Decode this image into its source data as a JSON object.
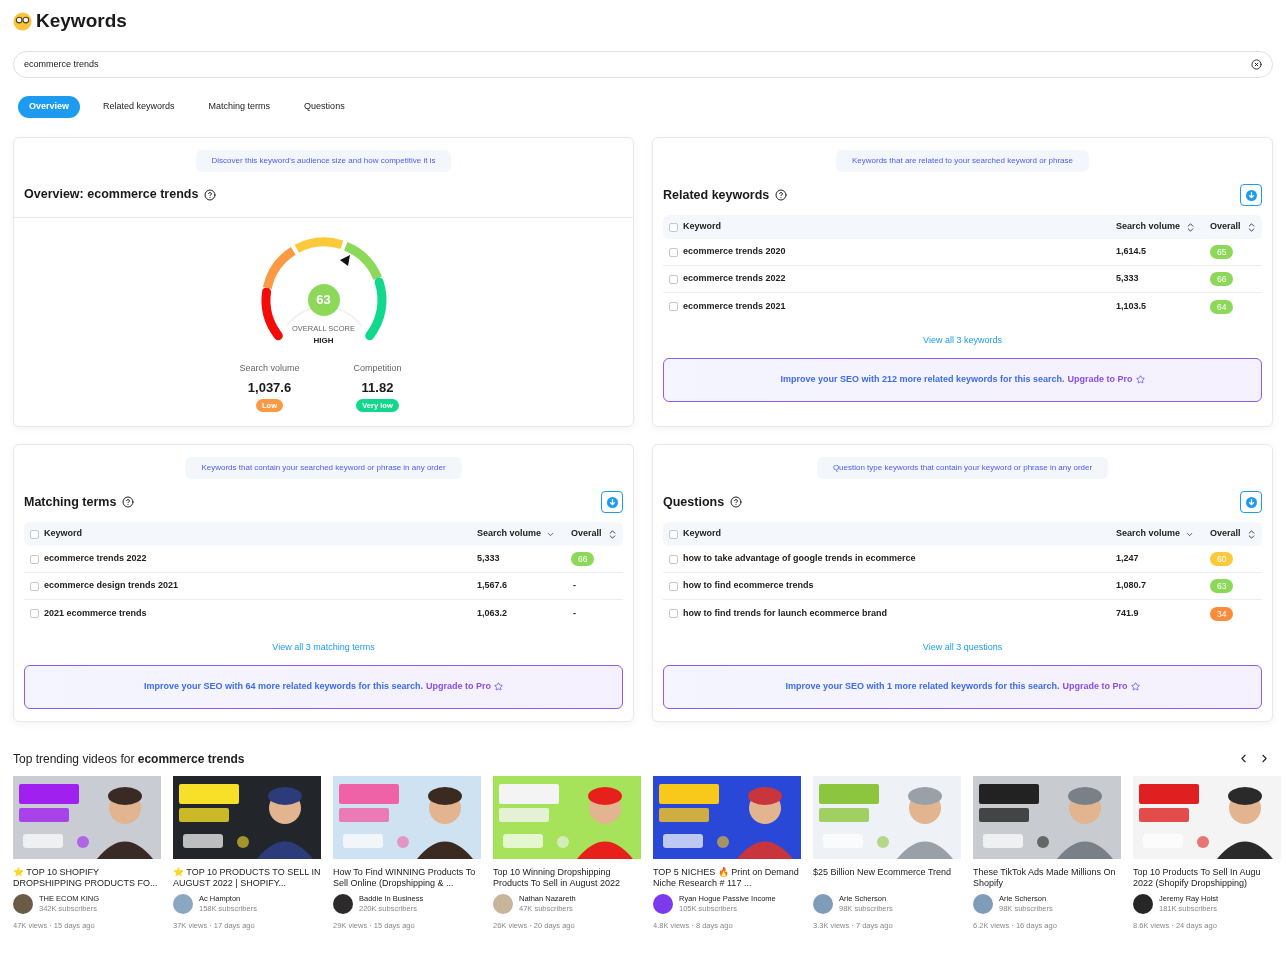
{
  "header": {
    "title": "Keywords"
  },
  "search": {
    "value": "ecommerce trends"
  },
  "tabs": [
    {
      "label": "Overview",
      "selected": true
    },
    {
      "label": "Related keywords",
      "selected": false
    },
    {
      "label": "Matching terms",
      "selected": false
    },
    {
      "label": "Questions",
      "selected": false
    }
  ],
  "overview": {
    "hint": "Discover this keyword's audience size and how competitive it is",
    "title": "Overview: ecommerce trends",
    "score": "63",
    "score_label": "OVERALL SCORE",
    "score_rating": "HIGH",
    "stats": [
      {
        "label": "Search volume",
        "value": "1,037.6",
        "badge": "Low",
        "color": "#fb9a45"
      },
      {
        "label": "Competition",
        "value": "11.82",
        "badge": "Very low",
        "color": "#10d98e"
      }
    ]
  },
  "related_keywords": {
    "hint": "Keywords that are related to your searched keyword or phrase",
    "title": "Related keywords",
    "all_checked": false,
    "columns": [
      {
        "label": "Keyword"
      },
      {
        "label": "Search volume",
        "sorted": false
      },
      {
        "label": "Overall",
        "sorted": false
      }
    ],
    "rows": [
      {
        "keyword": "ecommerce trends 2020",
        "volume": "1,614.5",
        "overall": "65",
        "color": "#8cd95a",
        "checked": false
      },
      {
        "keyword": "ecommerce trends 2022",
        "volume": "5,333",
        "overall": "66",
        "color": "#8cd95a",
        "checked": false
      },
      {
        "keyword": "ecommerce trends 2021",
        "volume": "1,103.5",
        "overall": "64",
        "color": "#8cd95a",
        "checked": false
      }
    ],
    "view_all": "View all 3 keywords",
    "upgrade": {
      "text": "Improve your SEO with 212 more related keywords for this search.",
      "link": "Upgrade to Pro"
    }
  },
  "matching_terms": {
    "hint": "Keywords that contain your searched keyword or phrase in any order",
    "title": "Matching terms",
    "all_checked": false,
    "columns": [
      {
        "label": "Keyword"
      },
      {
        "label": "Search volume",
        "sorted": true
      },
      {
        "label": "Overall",
        "sorted": false
      }
    ],
    "rows": [
      {
        "keyword": "ecommerce trends 2022",
        "volume": "5,333",
        "overall": "66",
        "color": "#8cd95a",
        "checked": false
      },
      {
        "keyword": "ecommerce design trends 2021",
        "volume": "1,567.6",
        "overall": "-",
        "checked": false
      },
      {
        "keyword": "2021 ecommerce trends",
        "volume": "1,063.2",
        "overall": "-",
        "checked": false
      }
    ],
    "view_all": "View all 3 matching terms",
    "upgrade": {
      "text": "Improve your SEO with 64 more related keywords for this search.",
      "link": "Upgrade to Pro"
    }
  },
  "questions": {
    "hint": "Question type keywords that contain your keyword or phrase in any order",
    "title": "Questions",
    "all_checked": false,
    "columns": [
      {
        "label": "Keyword"
      },
      {
        "label": "Search volume",
        "sorted": true
      },
      {
        "label": "Overall",
        "sorted": false
      }
    ],
    "rows": [
      {
        "keyword": "how to take advantage of google trends in ecommerce",
        "volume": "1,247",
        "overall": "60",
        "color": "#fcc93a",
        "checked": false
      },
      {
        "keyword": "how to find ecommerce trends",
        "volume": "1,080.7",
        "overall": "63",
        "color": "#8cd95a",
        "checked": false
      },
      {
        "keyword": "how to find trends for launch ecommerce brand",
        "volume": "741.9",
        "overall": "34",
        "color": "#fb8c3c",
        "checked": false
      }
    ],
    "view_all": "View all 3 questions",
    "upgrade": {
      "text": "Improve your SEO with 1 more related keywords for this search.",
      "link": "Upgrade to Pro"
    }
  },
  "videos": {
    "heading": "Top trending videos for **ecommerce trends**",
    "items": [
      {
        "title": "⭐ TOP 10 SHOPIFY DROPSHIPPING PRODUCTS FO...",
        "channel": "THE ECOM KING",
        "subscribers": "342K subscribers",
        "stats": "47K views · 15 days ago"
      },
      {
        "title": "⭐ TOP 10 PRODUCTS TO SELL IN AUGUST 2022 | SHOPIFY...",
        "channel": "Ac Hampton",
        "subscribers": "158K subscribers",
        "stats": "37K views · 17 days ago"
      },
      {
        "title": "How To Find WINNING Products To Sell Online (Dropshipping & ...",
        "channel": "Baddie In Business",
        "subscribers": "220K subscribers",
        "stats": "29K views · 15 days ago"
      },
      {
        "title": "Top 10 Winning Dropshipping Products To Sell in August 2022",
        "channel": "Nathan Nazareth",
        "subscribers": "47K subscribers",
        "stats": "26K views · 20 days ago"
      },
      {
        "title": "TOP 5 NICHES 🔥 Print on Demand Niche Research # 117 ...",
        "channel": "Ryan Hogue Passive Income",
        "subscribers": "105K subscribers",
        "stats": "4.8K views · 8 days ago"
      },
      {
        "title": "$25 Billion New Ecommerce Trend",
        "channel": "Arie Scherson",
        "subscribers": "98K subscribers",
        "stats": "3.3K views · 7 days ago"
      },
      {
        "title": "These TikTok Ads Made Millions On Shopify",
        "channel": "Arie Scherson",
        "subscribers": "98K subscribers",
        "stats": "6.2K views · 16 days ago"
      },
      {
        "title": "Top 10 Products To Sell In Augu 2022 (Shopify Dropshipping)",
        "channel": "Jeremy Ray Holst",
        "subscribers": "181K subscribers",
        "stats": "8.6K views · 24 days ago"
      }
    ]
  }
}
